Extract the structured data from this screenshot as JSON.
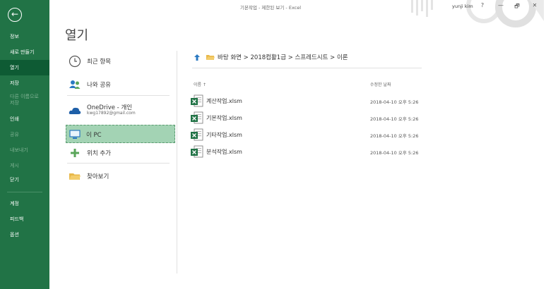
{
  "window": {
    "title": "기본작업 - 제한된 보기 - Excel",
    "user": "yunji kim",
    "help": "?",
    "minimize": "—",
    "restore": "🗗",
    "close": "✕"
  },
  "nav": {
    "back": "←",
    "items": [
      {
        "label": "정보",
        "state": "normal"
      },
      {
        "label": "새로 만들기",
        "state": "normal"
      },
      {
        "label": "열기",
        "state": "active"
      },
      {
        "label": "저장",
        "state": "normal"
      },
      {
        "label": "다른 이름으로 저장",
        "state": "disabled"
      },
      {
        "label": "인쇄",
        "state": "normal"
      },
      {
        "label": "공유",
        "state": "disabled"
      },
      {
        "label": "내보내기",
        "state": "disabled"
      },
      {
        "label": "게시",
        "state": "disabled"
      },
      {
        "label": "닫기",
        "state": "normal"
      },
      {
        "label": "계정",
        "state": "normal"
      },
      {
        "label": "피드백",
        "state": "normal"
      },
      {
        "label": "옵션",
        "state": "normal"
      }
    ]
  },
  "page": {
    "title": "열기"
  },
  "places": {
    "recent": "최근 항목",
    "shared": "나와 공유",
    "onedrive": "OneDrive - 개인",
    "onedrive_email": "kwg17892@gmail.com",
    "thispc": "이 PC",
    "add": "위치 추가",
    "browse": "찾아보기"
  },
  "breadcrumb": "바탕 화면 > 2018컴활1급 > 스프레드시트 > 이론",
  "columns": {
    "name": "이름 ↑",
    "modified": "수정한 날짜"
  },
  "files": [
    {
      "name": "계산작업.xlsm",
      "date": "2018-04-10 오후 5:26"
    },
    {
      "name": "기본작업.xlsm",
      "date": "2018-04-10 오후 5:26"
    },
    {
      "name": "기타작업.xlsm",
      "date": "2018-04-10 오후 5:26"
    },
    {
      "name": "분석작업.xlsm",
      "date": "2018-04-10 오후 5:26"
    }
  ],
  "colors": {
    "brand": "#217346",
    "active": "#0e5b34",
    "selected": "#a3d3b4"
  }
}
